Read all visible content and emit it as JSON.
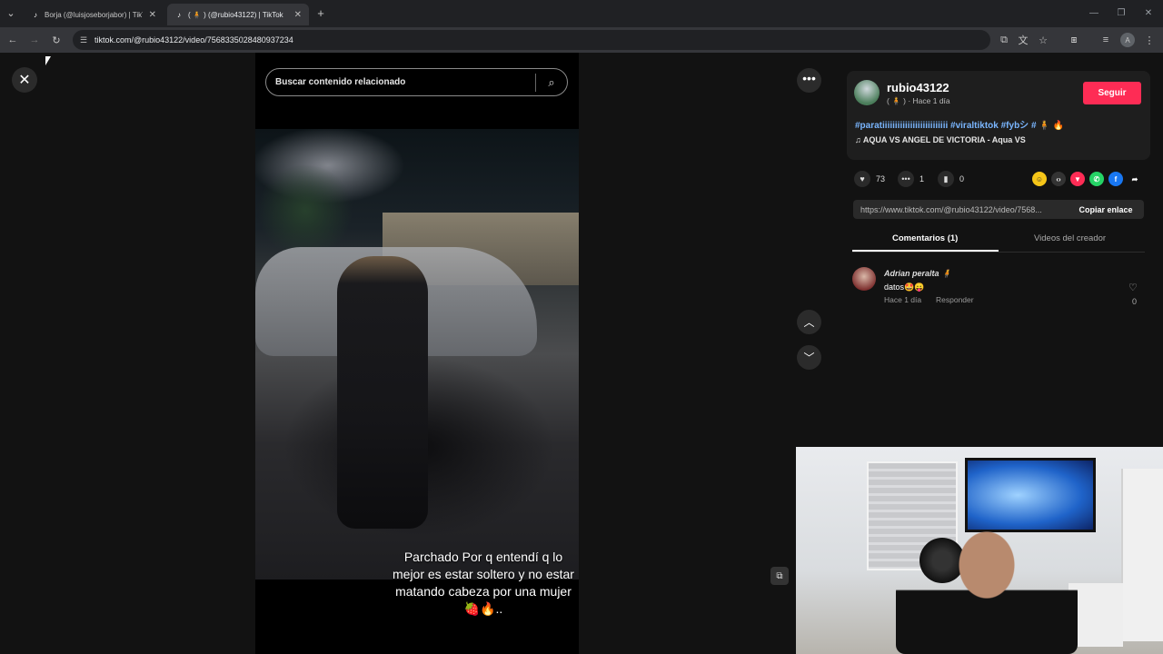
{
  "browser": {
    "tabs": [
      {
        "title": "Borja (@luisjoseborjabor) | TikT",
        "active": false
      },
      {
        "title": "( 🧍 ) (@rubio43122) | TikTok",
        "active": true
      }
    ],
    "new_tab": "+",
    "url": "tiktok.com/@rubio43122/video/7568335028480937234"
  },
  "video": {
    "search_placeholder": "Buscar contenido relacionado",
    "caption": "Parchado Por q entendí q lo mejor es estar soltero y no estar matando cabeza por una mujer 🍓🔥.."
  },
  "creator": {
    "username": "rubio43122",
    "meta": "( 🧍 ) · Hace 1 día",
    "follow_label": "Seguir",
    "hashtags": "#paratiiiiiiiiiiiiiiiiiiiiiiiiii #viraltiktok #fybシ # 🧍 🔥",
    "music": "AQUA VS ANGEL DE VICTORIA - Aqua VS"
  },
  "stats": {
    "likes": "73",
    "comments": "1",
    "saves": "0"
  },
  "share": {
    "link": "https://www.tiktok.com/@rubio43122/video/7568...",
    "copy_label": "Copiar enlace"
  },
  "panel_tabs": {
    "comments": "Comentarios (1)",
    "creator_videos": "Videos del creador"
  },
  "comments": [
    {
      "user": "Adrian peralta 🧍",
      "text": "datos🤩😛",
      "time": "Hace 1 día",
      "reply": "Responder",
      "likes": "0"
    }
  ],
  "colors": {
    "follow": "#fe2c55",
    "hashtag": "#7ab6ff",
    "background": "#121212"
  }
}
